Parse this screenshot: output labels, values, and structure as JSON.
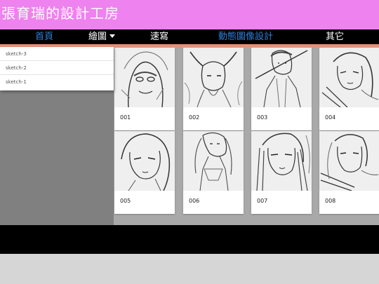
{
  "header": {
    "title": "張育瑞的設計工房"
  },
  "nav": {
    "items": [
      {
        "label": "首頁",
        "active": true
      },
      {
        "label": "繪圖",
        "active": false,
        "has_dropdown": true
      },
      {
        "label": "速寫",
        "active": false
      },
      {
        "label": "動態圖像設計",
        "active": true
      },
      {
        "label": "其它",
        "active": false
      }
    ]
  },
  "dropdown": {
    "items": [
      {
        "label": "sketch-3"
      },
      {
        "label": "sketch-2"
      },
      {
        "label": "sketch-1"
      }
    ]
  },
  "gallery": {
    "cards": [
      {
        "label": "001"
      },
      {
        "label": "002"
      },
      {
        "label": "003"
      },
      {
        "label": "004"
      },
      {
        "label": "005"
      },
      {
        "label": "006"
      },
      {
        "label": "007"
      },
      {
        "label": "008"
      }
    ]
  },
  "colors": {
    "header_bg": "#ee82ee",
    "nav_bg": "#000000",
    "nav_active": "#2f7fd8",
    "nav_underline": "#e88f7a",
    "sidebar_bg": "#808080",
    "content_bg": "#a9a9a9",
    "page_bg": "#d6d6d6"
  }
}
